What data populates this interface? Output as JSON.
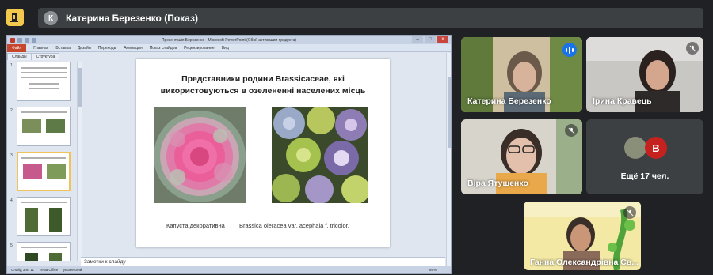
{
  "header": {
    "avatar_letter": "К",
    "title": "Катерина Березенко (Показ)"
  },
  "ppt": {
    "window_title": "Презентація Березенко - Microsoft PowerPoint (Сбой активации продукта)",
    "file_tab": "Файл",
    "ribbon_tabs": [
      "Главная",
      "Вставка",
      "Дизайн",
      "Переходы",
      "Анимация",
      "Показ слайдов",
      "Рецензирование",
      "Вид"
    ],
    "pane_tabs": [
      "Слайды",
      "Структура"
    ],
    "slide_numbers": [
      "1",
      "2",
      "3",
      "4",
      "5"
    ],
    "notes_placeholder": "Заметки к слайду",
    "status_left": "Слайд 3 из 11",
    "status_theme": "\"Тема Office\"",
    "status_lang": "украинский",
    "zoom": "86%"
  },
  "slide": {
    "title": "Представники родини Brassicaceae, які використовуються в озелененні населених  місць",
    "caption_left": "Капуста декоративна",
    "caption_right": "Brassica oleracea var. acephala f. tricolor."
  },
  "participants": [
    {
      "name": "Катерина Березенко",
      "speaking": true
    },
    {
      "name": "Ірина Кравець",
      "muted": true
    },
    {
      "name": "Віра Ятушенко",
      "muted": true
    },
    {
      "name": "Ганна Олександрівна Єв...",
      "muted": true
    }
  ],
  "more": {
    "avatar_letter": "В",
    "label": "Ещё 17 чел."
  },
  "colors": {
    "background": "#202124",
    "tile": "#3c4043",
    "logo": "#f2c94c",
    "avatar_b": "#c5221f",
    "speaking": "#1a73e8"
  }
}
